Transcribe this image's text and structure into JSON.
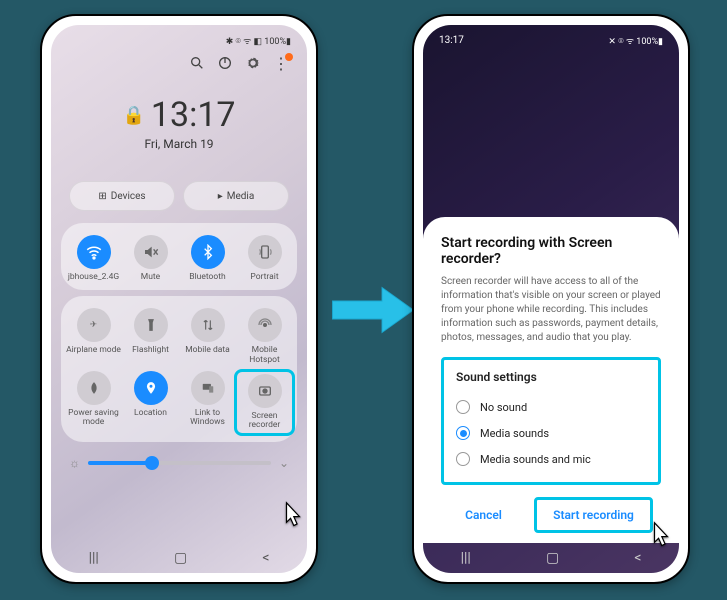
{
  "left": {
    "status": {
      "time": "",
      "icons": "✱ ⌾ ᯤ ◧ 100%▮"
    },
    "actions": [
      "search",
      "power",
      "gear"
    ],
    "clock": {
      "time": "13:17",
      "date": "Fri, March 19"
    },
    "pills": [
      {
        "icon": "⊞",
        "label": "Devices"
      },
      {
        "icon": "▸",
        "label": "Media"
      }
    ],
    "qs_row1": [
      {
        "label": "jbhouse_2.4G",
        "active": true,
        "glyph": "wifi"
      },
      {
        "label": "Mute",
        "active": false,
        "glyph": "mute"
      },
      {
        "label": "Bluetooth",
        "active": true,
        "glyph": "bt"
      },
      {
        "label": "Portrait",
        "active": false,
        "glyph": "portrait"
      }
    ],
    "qs_row2": [
      {
        "label": "Airplane mode",
        "glyph": "plane"
      },
      {
        "label": "Flashlight",
        "glyph": "flash"
      },
      {
        "label": "Mobile data",
        "glyph": "data"
      },
      {
        "label": "Mobile Hotspot",
        "glyph": "hotspot"
      }
    ],
    "qs_row3": [
      {
        "label": "Power saving mode",
        "glyph": "leaf"
      },
      {
        "label": "Location",
        "active": true,
        "glyph": "pin"
      },
      {
        "label": "Link to Windows",
        "glyph": "link"
      },
      {
        "label": "Screen recorder",
        "glyph": "rec",
        "highlight": true
      }
    ]
  },
  "right": {
    "status": {
      "time": "13:17",
      "icons": "✕ ⌾ ᯤ 100%▮"
    },
    "dialog": {
      "title": "Start recording with Screen recorder?",
      "body": "Screen recorder will have access to all of the information that's visible on your screen or played from your phone while recording. This includes information such as passwords, payment details, photos, messages, and audio that you play.",
      "sound_title": "Sound settings",
      "options": [
        {
          "label": "No sound",
          "checked": false
        },
        {
          "label": "Media sounds",
          "checked": true
        },
        {
          "label": "Media sounds and mic",
          "checked": false
        }
      ],
      "cancel": "Cancel",
      "start": "Start recording"
    }
  }
}
